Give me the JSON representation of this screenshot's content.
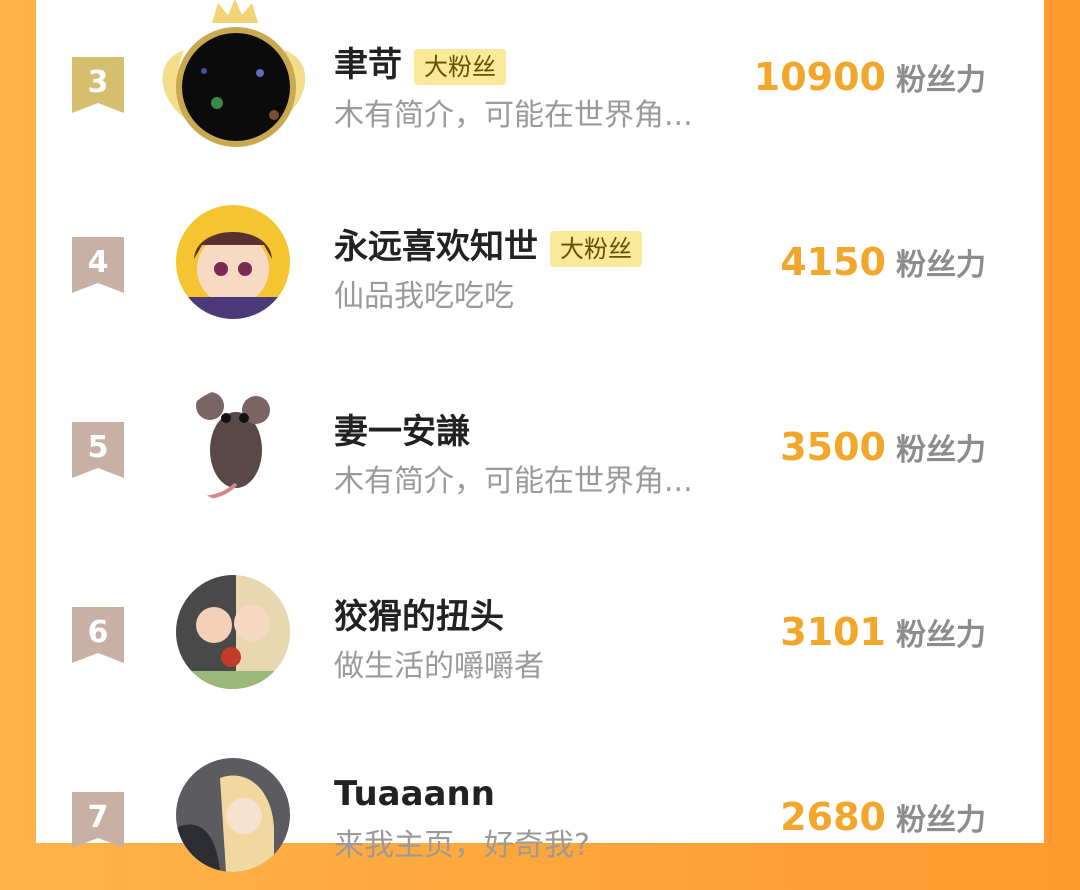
{
  "list": [
    {
      "rank": "3",
      "name": "聿苛",
      "badge": "大粉丝",
      "bio": "木有简介，可能在世界角...",
      "score": "10900",
      "unit": "粉丝力"
    },
    {
      "rank": "4",
      "name": "永远喜欢知世",
      "badge": "大粉丝",
      "bio": "仙品我吃吃吃",
      "score": "4150",
      "unit": "粉丝力"
    },
    {
      "rank": "5",
      "name": "妻一安謙",
      "badge": "",
      "bio": "木有简介，可能在世界角...",
      "score": "3500",
      "unit": "粉丝力"
    },
    {
      "rank": "6",
      "name": "狡猾的扭头",
      "badge": "",
      "bio": "做生活的嚼嚼者",
      "score": "3101",
      "unit": "粉丝力"
    },
    {
      "rank": "7",
      "name": "Tuaaann",
      "badge": "",
      "bio": "来我主页，好奇我?",
      "score": "2680",
      "unit": "粉丝力"
    }
  ],
  "colors": {
    "background": "#ffa63a",
    "score": "#f2a72b",
    "rank3": "#d5bf6e",
    "rank_other": "#c8b1a4",
    "badge_bg": "#fbe99a"
  },
  "icons": {
    "rank_badge": "ribbon-banner-icon",
    "crown": "crown-icon",
    "wings": "laurel-wings-icon"
  }
}
